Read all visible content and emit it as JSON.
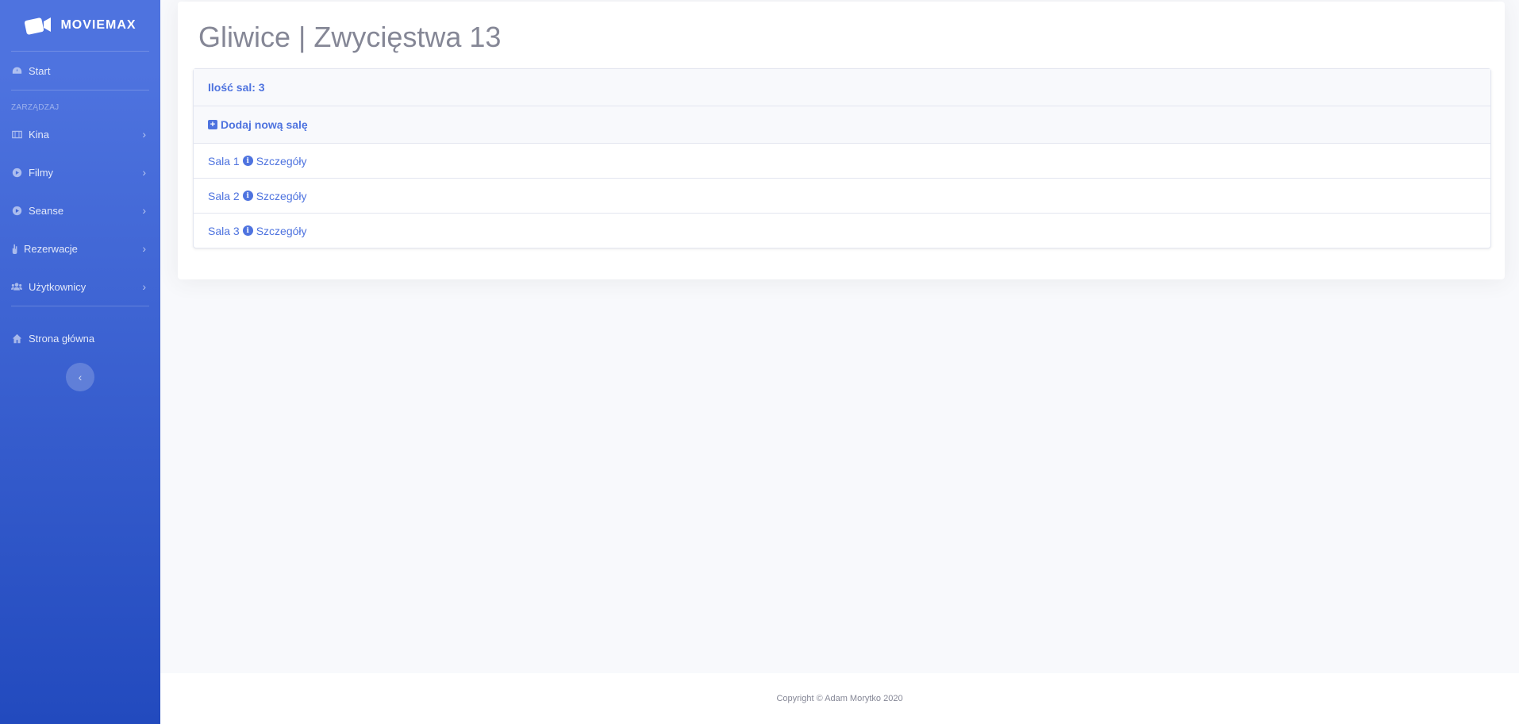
{
  "sidebar": {
    "brand": "MOVIEMAX",
    "start_label": "Start",
    "heading": "ZARZĄDZAJ",
    "items": [
      {
        "label": "Kina"
      },
      {
        "label": "Filmy"
      },
      {
        "label": "Seanse"
      },
      {
        "label": "Rezerwacje"
      },
      {
        "label": "Użytkownicy"
      }
    ],
    "home_label": "Strona główna",
    "toggle_glyph": "‹"
  },
  "main": {
    "title": "Gliwice | Zwycięstwa 13",
    "rooms_count_label": "Ilość sal: 3",
    "add_room_label": "Dodaj nową salę",
    "rooms": [
      {
        "name": "Sala 1",
        "details": "Szczegóły"
      },
      {
        "name": "Sala 2",
        "details": "Szczegóły"
      },
      {
        "name": "Sala 3",
        "details": "Szczegóły"
      }
    ]
  },
  "footer": {
    "copyright": "Copyright © Adam Morytko 2020"
  },
  "colors": {
    "primary": "#4e73df",
    "sidebar_gradient_end": "#224abe",
    "text_muted": "#858796",
    "background": "#f8f9fc"
  },
  "icons": {
    "brand": "video-camera-icon",
    "start": "dashboard-icon",
    "kina": "film-icon",
    "filmy": "play-circle-icon",
    "seanse": "play-icon",
    "rezerwacje": "hand-icon",
    "uzytkownicy": "users-icon",
    "home": "home-icon",
    "add": "plus-square-icon",
    "info": "info-circle-icon"
  }
}
